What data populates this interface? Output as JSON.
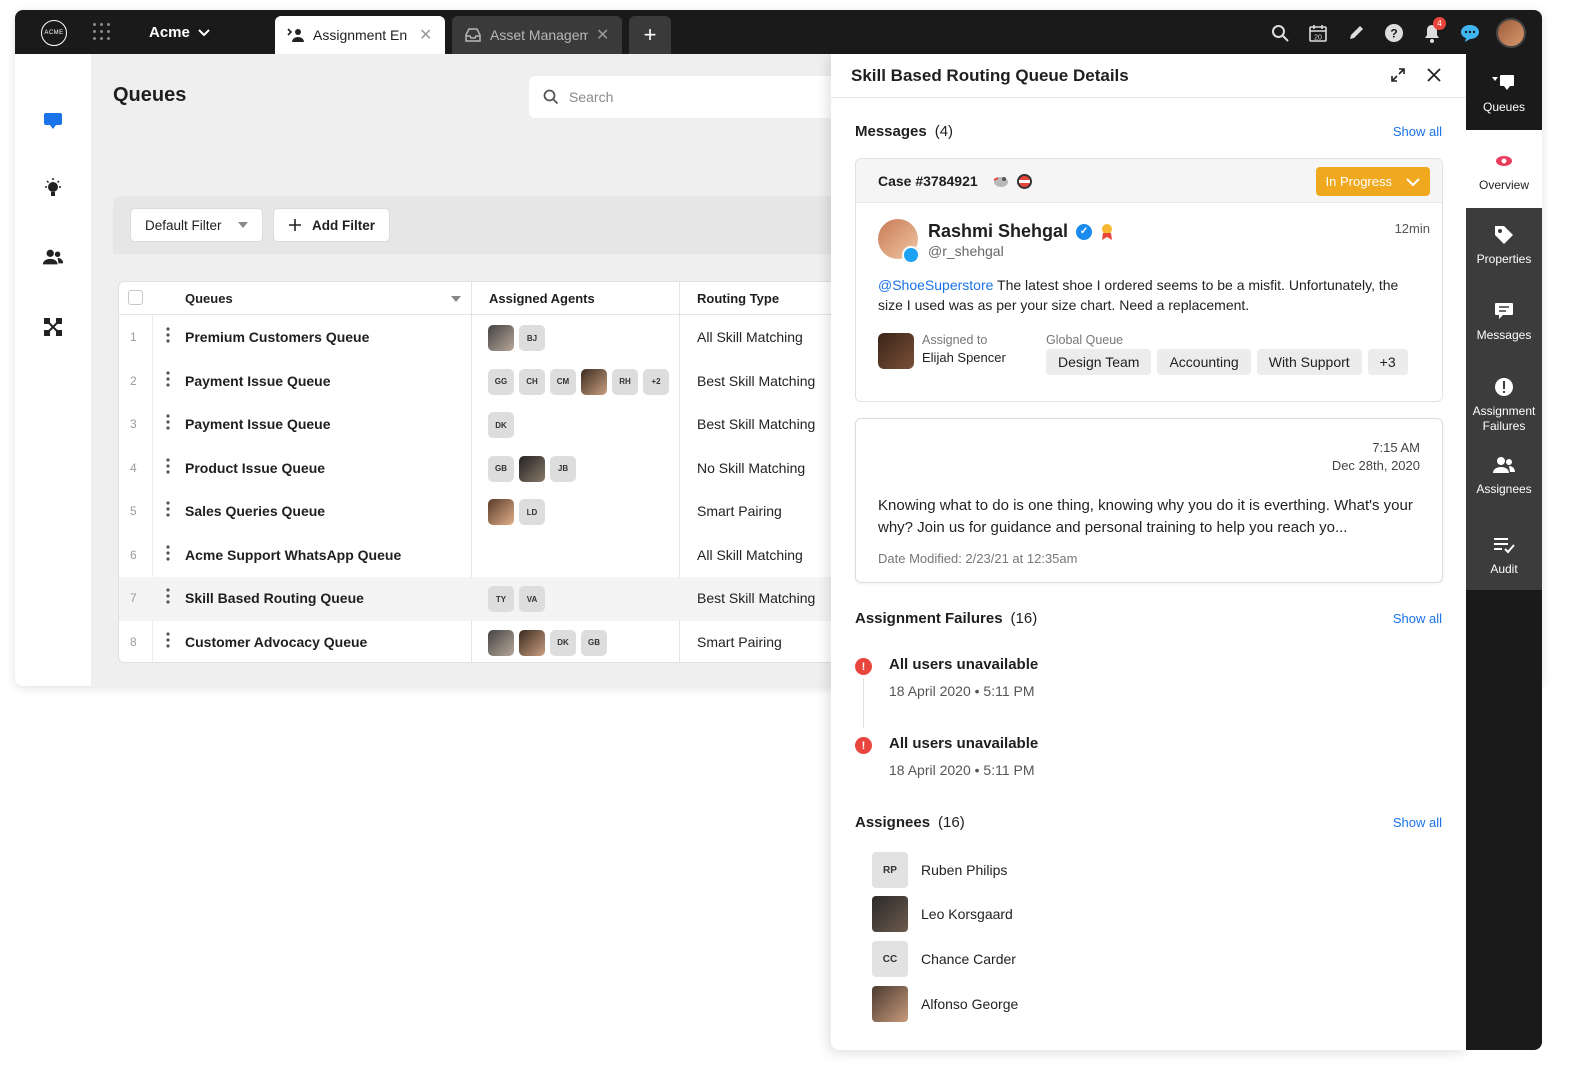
{
  "topbar": {
    "logo_text": "ACME",
    "brand": "Acme",
    "tabs": [
      {
        "label": "Assignment En",
        "active": true
      },
      {
        "label": "Asset Managem",
        "active": false
      }
    ],
    "notification_count": "4",
    "calendar_day": "20"
  },
  "main": {
    "title": "Queues",
    "search_placeholder": "Search",
    "filters": {
      "default": "Default Filter",
      "add": "Add Filter"
    },
    "columns": [
      "Queues",
      "Assigned Agents",
      "Routing Type"
    ],
    "rows": [
      {
        "num": "1",
        "name": "Premium Customers Queue",
        "agents": [
          {
            "photo": true
          },
          {
            "initials": "BJ"
          }
        ],
        "routing": "All Skill Matching"
      },
      {
        "num": "2",
        "name": "Payment Issue Queue",
        "agents": [
          {
            "initials": "GG"
          },
          {
            "initials": "CH"
          },
          {
            "initials": "CM"
          },
          {
            "photo": true
          },
          {
            "initials": "RH"
          },
          {
            "initials": "+2"
          }
        ],
        "routing": "Best Skill Matching"
      },
      {
        "num": "3",
        "name": "Payment Issue Queue",
        "agents": [
          {
            "initials": "DK"
          }
        ],
        "routing": "Best Skill Matching"
      },
      {
        "num": "4",
        "name": "Product Issue Queue",
        "agents": [
          {
            "initials": "GB"
          },
          {
            "photo": true
          },
          {
            "initials": "JB"
          }
        ],
        "routing": "No Skill Matching"
      },
      {
        "num": "5",
        "name": "Sales Queries Queue",
        "agents": [
          {
            "photo": true
          },
          {
            "initials": "LD"
          }
        ],
        "routing": "Smart Pairing"
      },
      {
        "num": "6",
        "name": "Acme Support WhatsApp Queue",
        "agents": [],
        "routing": "All Skill Matching"
      },
      {
        "num": "7",
        "name": "Skill Based Routing Queue",
        "agents": [
          {
            "initials": "TY"
          },
          {
            "initials": "VA"
          }
        ],
        "routing": "Best Skill Matching",
        "highlighted": true
      },
      {
        "num": "8",
        "name": "Customer Advocacy Queue",
        "agents": [
          {
            "photo": true
          },
          {
            "photo": true
          },
          {
            "initials": "DK"
          },
          {
            "initials": "GB"
          }
        ],
        "routing": "Smart Pairing"
      }
    ]
  },
  "panel": {
    "title": "Skill Based Routing Queue Details",
    "messages": {
      "title": "Messages",
      "count": "(4)",
      "show_all": "Show all",
      "case": {
        "id": "Case #3784921",
        "status": "In Progress",
        "user_name": "Rashmi Shehgal",
        "handle": "@r_shehgal",
        "time": "12min",
        "mention": "@ShoeSuperstore",
        "text": " The latest shoe I ordered seems to be a misfit. Unfortunately, the size I used was as per your size chart. Need a replacement.",
        "assigned_label": "Assigned to",
        "assigned_to": "Elijah Spencer",
        "queue_label": "Global Queue",
        "tags": [
          "Design Team",
          "Accounting",
          "With Support",
          "+3"
        ]
      },
      "note": {
        "time": "7:15 AM",
        "date": "Dec 28th, 2020",
        "text": "Knowing what to do is one thing, knowing why you do it is everthing. What's your why? Join us for guidance and personal training to help you reach yo...",
        "modified": "Date Modified: 2/23/21 at 12:35am"
      }
    },
    "failures": {
      "title": "Assignment Failures",
      "count": "(16)",
      "show_all": "Show all",
      "items": [
        {
          "title": "All users unavailable",
          "date": "18 April 2020 • 5:11 PM"
        },
        {
          "title": "All users unavailable",
          "date": "18 April 2020 • 5:11 PM"
        }
      ]
    },
    "assignees": {
      "title": "Assignees",
      "count": "(16)",
      "show_all": "Show all",
      "items": [
        {
          "initials": "RP",
          "name": "Ruben Philips"
        },
        {
          "initials": "",
          "name": "Leo Korsgaard"
        },
        {
          "initials": "CC",
          "name": "Chance Carder"
        },
        {
          "initials": "",
          "name": "Alfonso George"
        }
      ]
    }
  },
  "dock": {
    "items": [
      "Queues",
      "Overview",
      "Properties",
      "Messages",
      "Assignment Failures",
      "Assignees",
      "Audit"
    ]
  },
  "colors": {
    "accent_blue": "#1a73e8",
    "status_orange": "#f0a81e",
    "error_red": "#e8453c",
    "topbar": "#1a1a1a"
  }
}
